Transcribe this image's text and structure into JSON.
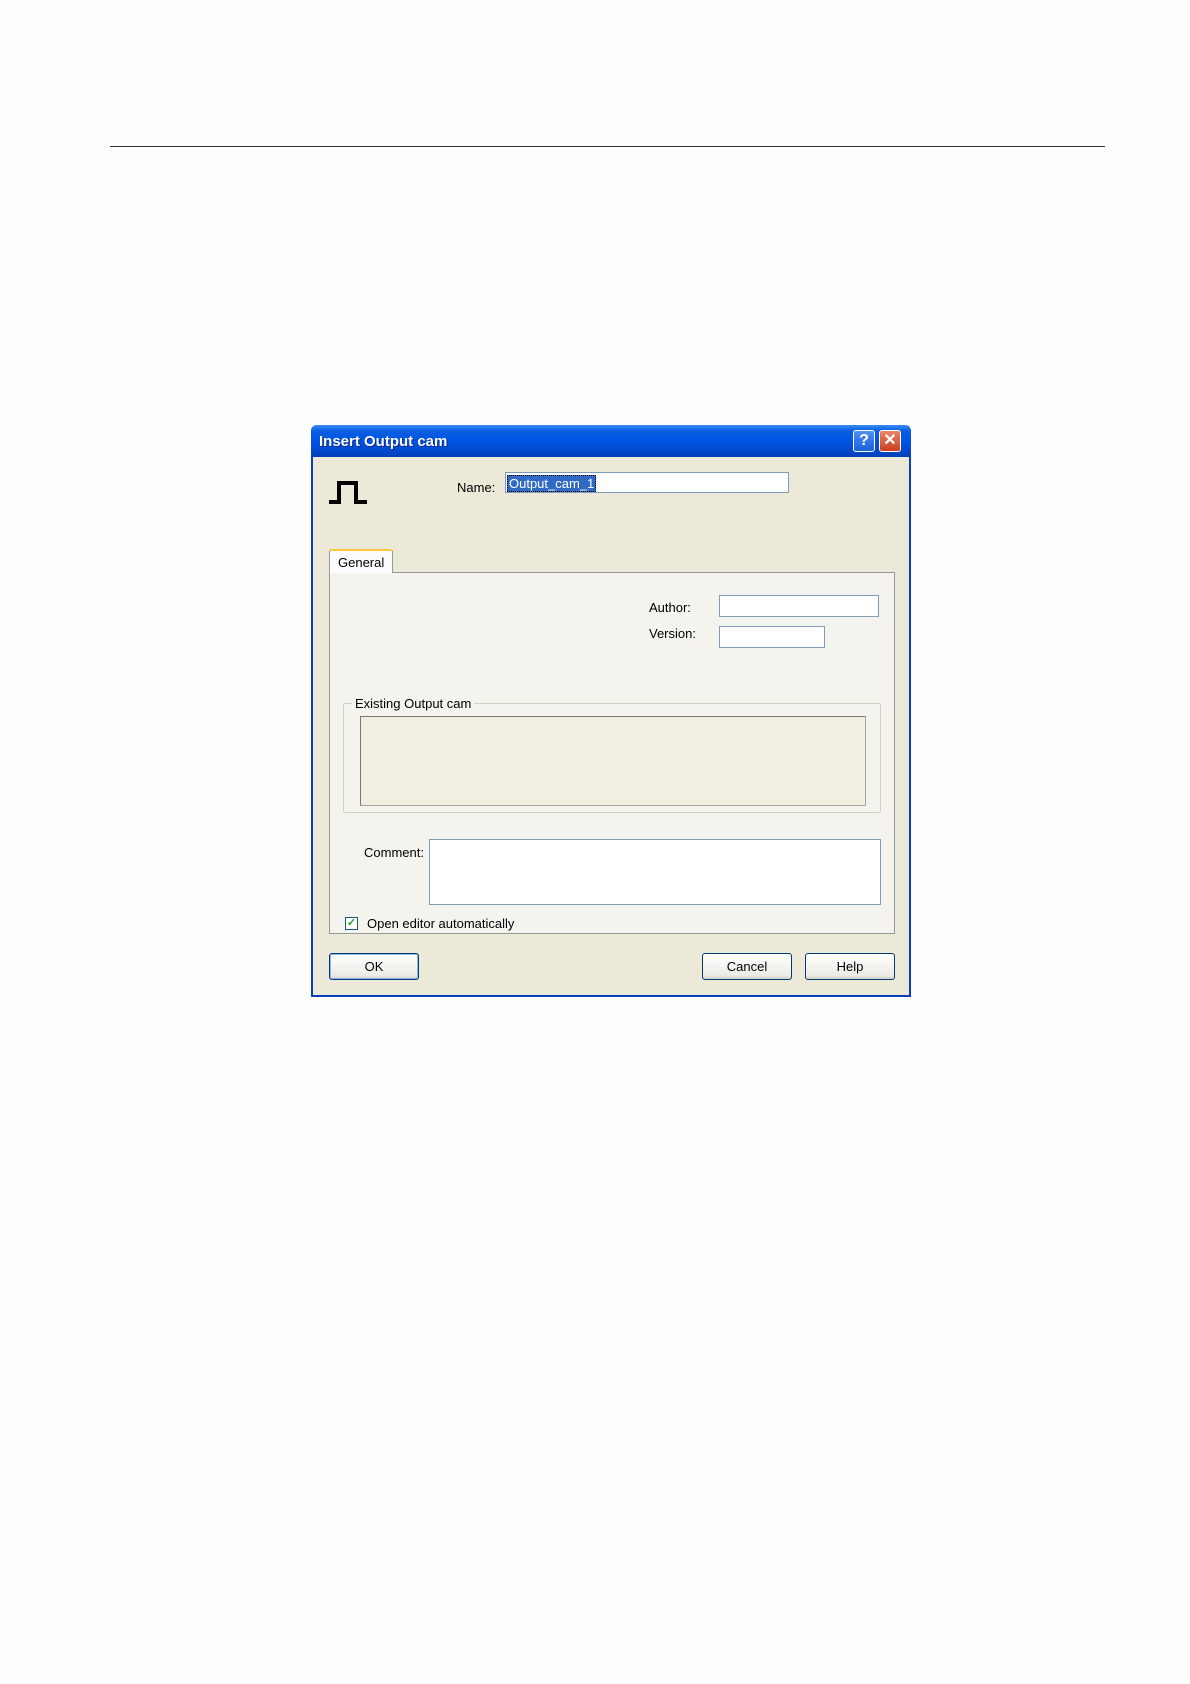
{
  "dialog": {
    "title": "Insert Output cam",
    "help_button": "?",
    "close_button": "✕"
  },
  "name_field": {
    "label": "Name:",
    "value": "Output_cam_1"
  },
  "tabs": [
    {
      "label": "General"
    }
  ],
  "general": {
    "author_label": "Author:",
    "author_value": "",
    "version_label": "Version:",
    "version_value": "",
    "existing_group_label": "Existing Output cam",
    "comment_label": "Comment:",
    "comment_value": "",
    "open_editor_label": "Open editor automatically",
    "open_editor_checked": true
  },
  "buttons": {
    "ok": "OK",
    "cancel": "Cancel",
    "help": "Help"
  }
}
